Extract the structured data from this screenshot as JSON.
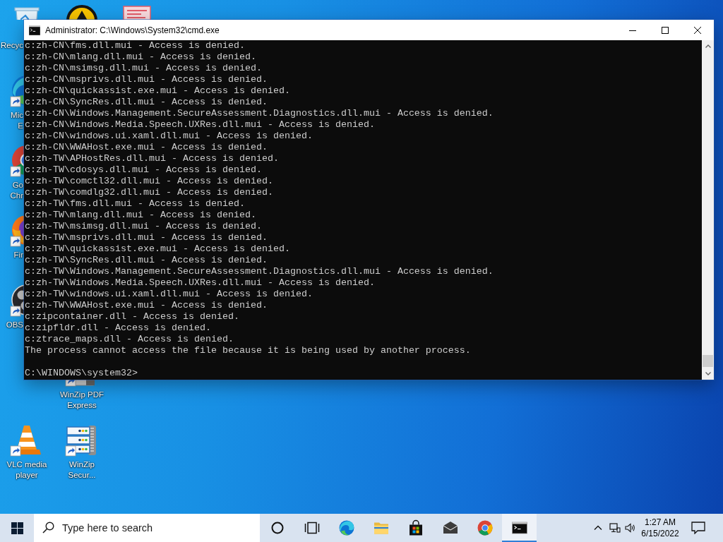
{
  "desktop": {
    "icons": [
      {
        "kind": "recycle-bin",
        "label_lines": [
          "Recyc"
        ]
      },
      {
        "kind": "edge",
        "shortcut": true,
        "label_lines": [
          "Mic",
          "E"
        ]
      },
      {
        "kind": "chrome",
        "shortcut": true,
        "label_lines": [
          "Go",
          "Chr"
        ]
      },
      {
        "kind": "firefox",
        "shortcut": true,
        "label_lines": [
          "Fir"
        ]
      },
      {
        "kind": "obs",
        "shortcut": true,
        "label_lines": [
          "OBS"
        ]
      },
      {
        "kind": "vlc",
        "shortcut": true,
        "label_lines": [
          "VLC media",
          "player"
        ]
      },
      {
        "kind": "circle-triangle"
      },
      {
        "kind": "winzip-pdf",
        "shortcut": true,
        "label_lines": [
          "WinZip PDF",
          "Express"
        ]
      },
      {
        "kind": "winzip-secure",
        "shortcut": true,
        "label_lines": [
          "WinZip",
          "Secur..."
        ]
      },
      {
        "kind": "lined-panel"
      }
    ]
  },
  "window": {
    "title": "Administrator: C:\\Windows\\System32\\cmd.exe",
    "output_lines": [
      "c:zh-CN\\fms.dll.mui - Access is denied.",
      "c:zh-CN\\mlang.dll.mui - Access is denied.",
      "c:zh-CN\\msimsg.dll.mui - Access is denied.",
      "c:zh-CN\\msprivs.dll.mui - Access is denied.",
      "c:zh-CN\\quickassist.exe.mui - Access is denied.",
      "c:zh-CN\\SyncRes.dll.mui - Access is denied.",
      "c:zh-CN\\Windows.Management.SecureAssessment.Diagnostics.dll.mui - Access is denied.",
      "c:zh-CN\\Windows.Media.Speech.UXRes.dll.mui - Access is denied.",
      "c:zh-CN\\windows.ui.xaml.dll.mui - Access is denied.",
      "c:zh-CN\\WWAHost.exe.mui - Access is denied.",
      "c:zh-TW\\APHostRes.dll.mui - Access is denied.",
      "c:zh-TW\\cdosys.dll.mui - Access is denied.",
      "c:zh-TW\\comctl32.dll.mui - Access is denied.",
      "c:zh-TW\\comdlg32.dll.mui - Access is denied.",
      "c:zh-TW\\fms.dll.mui - Access is denied.",
      "c:zh-TW\\mlang.dll.mui - Access is denied.",
      "c:zh-TW\\msimsg.dll.mui - Access is denied.",
      "c:zh-TW\\msprivs.dll.mui - Access is denied.",
      "c:zh-TW\\quickassist.exe.mui - Access is denied.",
      "c:zh-TW\\SyncRes.dll.mui - Access is denied.",
      "c:zh-TW\\Windows.Management.SecureAssessment.Diagnostics.dll.mui - Access is denied.",
      "c:zh-TW\\Windows.Media.Speech.UXRes.dll.mui - Access is denied.",
      "c:zh-TW\\windows.ui.xaml.dll.mui - Access is denied.",
      "c:zh-TW\\WWAHost.exe.mui - Access is denied.",
      "c:zipcontainer.dll - Access is denied.",
      "c:zipfldr.dll - Access is denied.",
      "c:ztrace_maps.dll - Access is denied.",
      "The process cannot access the file because it is being used by another process."
    ],
    "prompt": "C:\\WINDOWS\\system32>"
  },
  "taskbar": {
    "search": {
      "placeholder": "Type here to search"
    },
    "apps": [
      {
        "kind": "cortana",
        "active": false
      },
      {
        "kind": "task-view",
        "active": false
      },
      {
        "kind": "edge",
        "active": false
      },
      {
        "kind": "explorer",
        "active": false
      },
      {
        "kind": "store",
        "active": false
      },
      {
        "kind": "mail",
        "active": false
      },
      {
        "kind": "chrome",
        "active": false
      },
      {
        "kind": "terminal",
        "active": true
      }
    ],
    "clock": {
      "time": "1:27 AM",
      "date": "6/15/2022"
    }
  }
}
